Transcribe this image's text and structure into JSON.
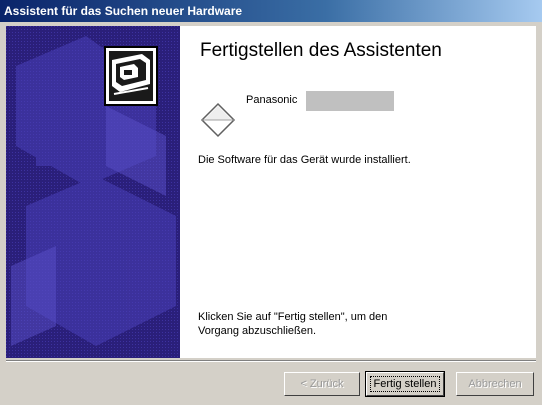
{
  "window": {
    "title": "Assistent für das Suchen neuer Hardware"
  },
  "main": {
    "heading": "Fertigstellen des Assistenten",
    "device_name": "Panasonic",
    "status": "Die Software für das Gerät wurde installiert.",
    "hint_line1": "Klicken Sie auf \"Fertig stellen\", um den",
    "hint_line2": "Vorgang abzuschließen."
  },
  "buttons": {
    "back": "< Zurück",
    "finish": "Fertig stellen",
    "cancel": "Abbrechen"
  },
  "icons": {
    "wizard": "hardware-wizard-icon",
    "device": "device-diamond-icon"
  },
  "colors": {
    "banner": "#2a1f7a",
    "title_start": "#0a246a",
    "title_end": "#a6caf0"
  }
}
